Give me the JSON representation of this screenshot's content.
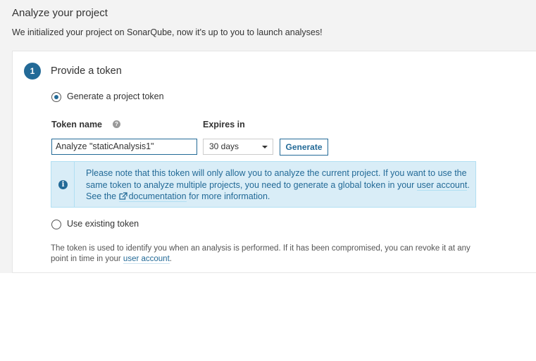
{
  "page": {
    "title": "Analyze your project",
    "subtitle": "We initialized your project on SonarQube, now it's up to you to launch analyses!"
  },
  "step": {
    "number": "1",
    "title": "Provide a token"
  },
  "options": {
    "generate_label": "Generate a project token",
    "existing_label": "Use existing token",
    "selected": "generate"
  },
  "form": {
    "token_name_label": "Token name",
    "token_name_value": "Analyze \"staticAnalysis1\"",
    "expires_label": "Expires in",
    "expires_value": "30 days",
    "generate_button": "Generate"
  },
  "alert": {
    "text_1": "Please note that this token will only allow you to analyze the current project. If you want to use the same token to analyze multiple projects, you need to generate a global token in your ",
    "link_account": "user account",
    "text_2": ". See the ",
    "link_docs": "documentation",
    "text_3": " for more information."
  },
  "footnote": {
    "text_1": "The token is used to identify you when an analysis is performed. If it has been compromised, you can revoke it at any point in time in your ",
    "link": "user account",
    "text_2": "."
  },
  "colors": {
    "primary": "#236a97",
    "alert_bg": "#d9edf7",
    "page_bg": "#f3f3f3"
  },
  "icons": [
    "help-icon",
    "info-icon",
    "external-link-icon",
    "caret-down-icon"
  ]
}
